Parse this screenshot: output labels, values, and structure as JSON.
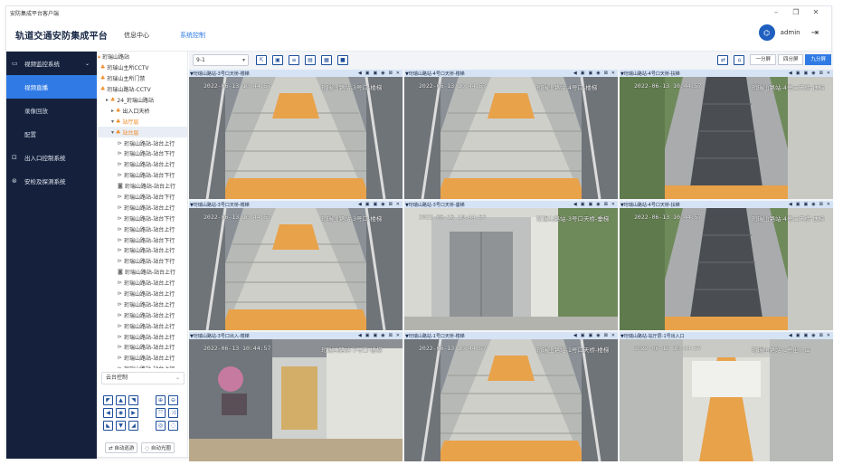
{
  "window": {
    "title": "安防集成平台客户端",
    "controls": [
      "–",
      "❐",
      "✕"
    ]
  },
  "appbar": {
    "brand": "轨道交通安防集成平台",
    "nav": [
      "信息中心",
      "系统控制"
    ],
    "username": "admin",
    "colors": {
      "accent": "#2f7ae5",
      "nav_bg": "#15213c"
    }
  },
  "sidenav": {
    "groups": [
      {
        "label": "视频监控系统",
        "subitems": [
          "视频直播",
          "录像回放",
          "配置"
        ],
        "active": "视频直播"
      },
      {
        "label": "出入口控制系统"
      },
      {
        "label": "安检及探测系统"
      }
    ]
  },
  "tree": {
    "rows": [
      {
        "label": "珩瑞山路站",
        "level": 0,
        "icon": "station-icon"
      },
      {
        "label": "珩瑞山主所CCTV",
        "level": 1,
        "icon": "org-icon"
      },
      {
        "label": "珩瑞山主所门禁",
        "level": 1,
        "icon": "org-icon"
      },
      {
        "label": "珩瑞山路站-CCTV",
        "level": 1,
        "icon": "org-icon"
      },
      {
        "label": "24_珩瑞山路站",
        "level": 2,
        "icon": "org-icon"
      },
      {
        "label": "出入口天桥",
        "level": 3,
        "icon": "org-icon"
      },
      {
        "label": "站厅层",
        "level": 3,
        "icon": "org-icon",
        "orange": true
      },
      {
        "label": "站台层",
        "level": 3,
        "icon": "org-icon",
        "orange": true,
        "selected": true
      },
      {
        "label": "珩瑞山路站-站台上行",
        "level": 4,
        "icon": "camera-icon"
      },
      {
        "label": "珩瑞山路站-站台下行",
        "level": 4,
        "icon": "camera-icon"
      },
      {
        "label": "珩瑞山路站-站台上行",
        "level": 4,
        "icon": "camera-icon"
      },
      {
        "label": "珩瑞山路站-站台下行",
        "level": 4,
        "icon": "camera-icon"
      },
      {
        "label": "珩瑞山路站-站台上行",
        "level": 4,
        "icon": "dome-icon"
      },
      {
        "label": "珩瑞山路站-站台下行",
        "level": 4,
        "icon": "camera-icon"
      },
      {
        "label": "珩瑞山路站-站台上行",
        "level": 4,
        "icon": "camera-icon"
      },
      {
        "label": "珩瑞山路站-站台下行",
        "level": 4,
        "icon": "camera-icon"
      },
      {
        "label": "珩瑞山路站-站台上行",
        "level": 4,
        "icon": "camera-icon"
      },
      {
        "label": "珩瑞山路站-站台下行",
        "level": 4,
        "icon": "camera-icon"
      },
      {
        "label": "珩瑞山路站-站台上行",
        "level": 4,
        "icon": "camera-icon"
      },
      {
        "label": "珩瑞山路站-站台下行",
        "level": 4,
        "icon": "camera-icon"
      },
      {
        "label": "珩瑞山路站-站台上行",
        "level": 4,
        "icon": "dome-icon"
      },
      {
        "label": "珩瑞山路站-站台上行",
        "level": 4,
        "icon": "camera-icon"
      },
      {
        "label": "珩瑞山路站-站台上行",
        "level": 4,
        "icon": "camera-icon"
      },
      {
        "label": "珩瑞山路站-站台上行",
        "level": 4,
        "icon": "camera-icon"
      },
      {
        "label": "珩瑞山路站-站台上行",
        "level": 4,
        "icon": "camera-icon"
      },
      {
        "label": "珩瑞山路站-站台上行",
        "level": 4,
        "icon": "camera-icon"
      },
      {
        "label": "珩瑞山路站-站台上行",
        "level": 4,
        "icon": "camera-icon"
      },
      {
        "label": "珩瑞山路站-站台上行",
        "level": 4,
        "icon": "camera-icon"
      },
      {
        "label": "珩瑞山路站-站台上行",
        "level": 4,
        "icon": "camera-icon"
      },
      {
        "label": "珩瑞山路站-站台上行",
        "level": 4,
        "icon": "camera-icon"
      }
    ]
  },
  "ptz": {
    "select_value": "云台控制",
    "pad": [
      "◤",
      "▲",
      "◥",
      "◀",
      "◉",
      "▶",
      "◣",
      "▼",
      "◢"
    ],
    "zoom": [
      "⊕",
      "⊖",
      "⤧",
      "⤨",
      "◎",
      "◌"
    ],
    "buttons": [
      "⇄ 自动巡游",
      "◌ 自动光圈"
    ]
  },
  "video": {
    "stream_select": "9-1",
    "toolbar_icons": [
      "popout-icon",
      "snapshot-icon",
      "list-icon",
      "record-icon",
      "image-icon",
      "video-icon"
    ],
    "split_buttons": [
      "一分屏",
      "四分屏",
      "九分屏"
    ],
    "active_split": "九分屏",
    "cells": [
      {
        "title": "▼珩瑞山路站-3号口天桥-楼梯",
        "osd": "2022-06-13 10:44:57",
        "osd2": "珩瑞山路站-3号口-楼梯",
        "scene": "stairs"
      },
      {
        "title": "▼珩瑞山路站-4号口天桥-楼梯",
        "osd": "2022-06-13 10:44:57",
        "osd2": "珩瑞山路站-4号口-楼梯",
        "scene": "stairs"
      },
      {
        "title": "▼珩瑞山路站-4号口天桥-扶梯",
        "osd": "2022-06-13 10:44:57",
        "osd2": "珩瑞山路站-4号口天桥-扶梯",
        "scene": "escalator"
      },
      {
        "title": "▼珩瑞山路站-3号口天桥-楼梯",
        "osd": "2022-06-13 10:44:57",
        "osd2": "珩瑞山路站-3号口-楼梯",
        "scene": "stairs"
      },
      {
        "title": "▼珩瑞山路站-3号口天桥-垂梯",
        "osd": "2022-06-13 10:44:57",
        "osd2": "珩瑞山路站-3号口天桥-垂梯",
        "scene": "elevator"
      },
      {
        "title": "▼珩瑞山路站-4号口天桥-扶梯",
        "osd": "2022-06-13 10:44:57",
        "osd2": "珩瑞山路站-4号口天桥-扶梯",
        "scene": "escalator"
      },
      {
        "title": "▼珩瑞山路站-3号口出入-楼梯",
        "osd": "2022-06-13 10:44:57",
        "osd2": "珩瑞山路站-3号口-楼梯",
        "scene": "street"
      },
      {
        "title": "▼珩瑞山路站-1号口天桥-楼梯",
        "osd": "2022-06-13 10:44:57",
        "osd2": "珩瑞山路站-1号口天桥-楼梯",
        "scene": "stairs2"
      },
      {
        "title": "▼珩瑞山路站-站厅层-1号出入口",
        "osd": "2022-06-13 10:44:57",
        "osd2": "珩瑞山路站-1号出入口",
        "scene": "corridor"
      }
    ],
    "cell_controls": [
      "◀",
      "▣",
      "▣",
      "◉",
      "⊠",
      "✕"
    ]
  }
}
